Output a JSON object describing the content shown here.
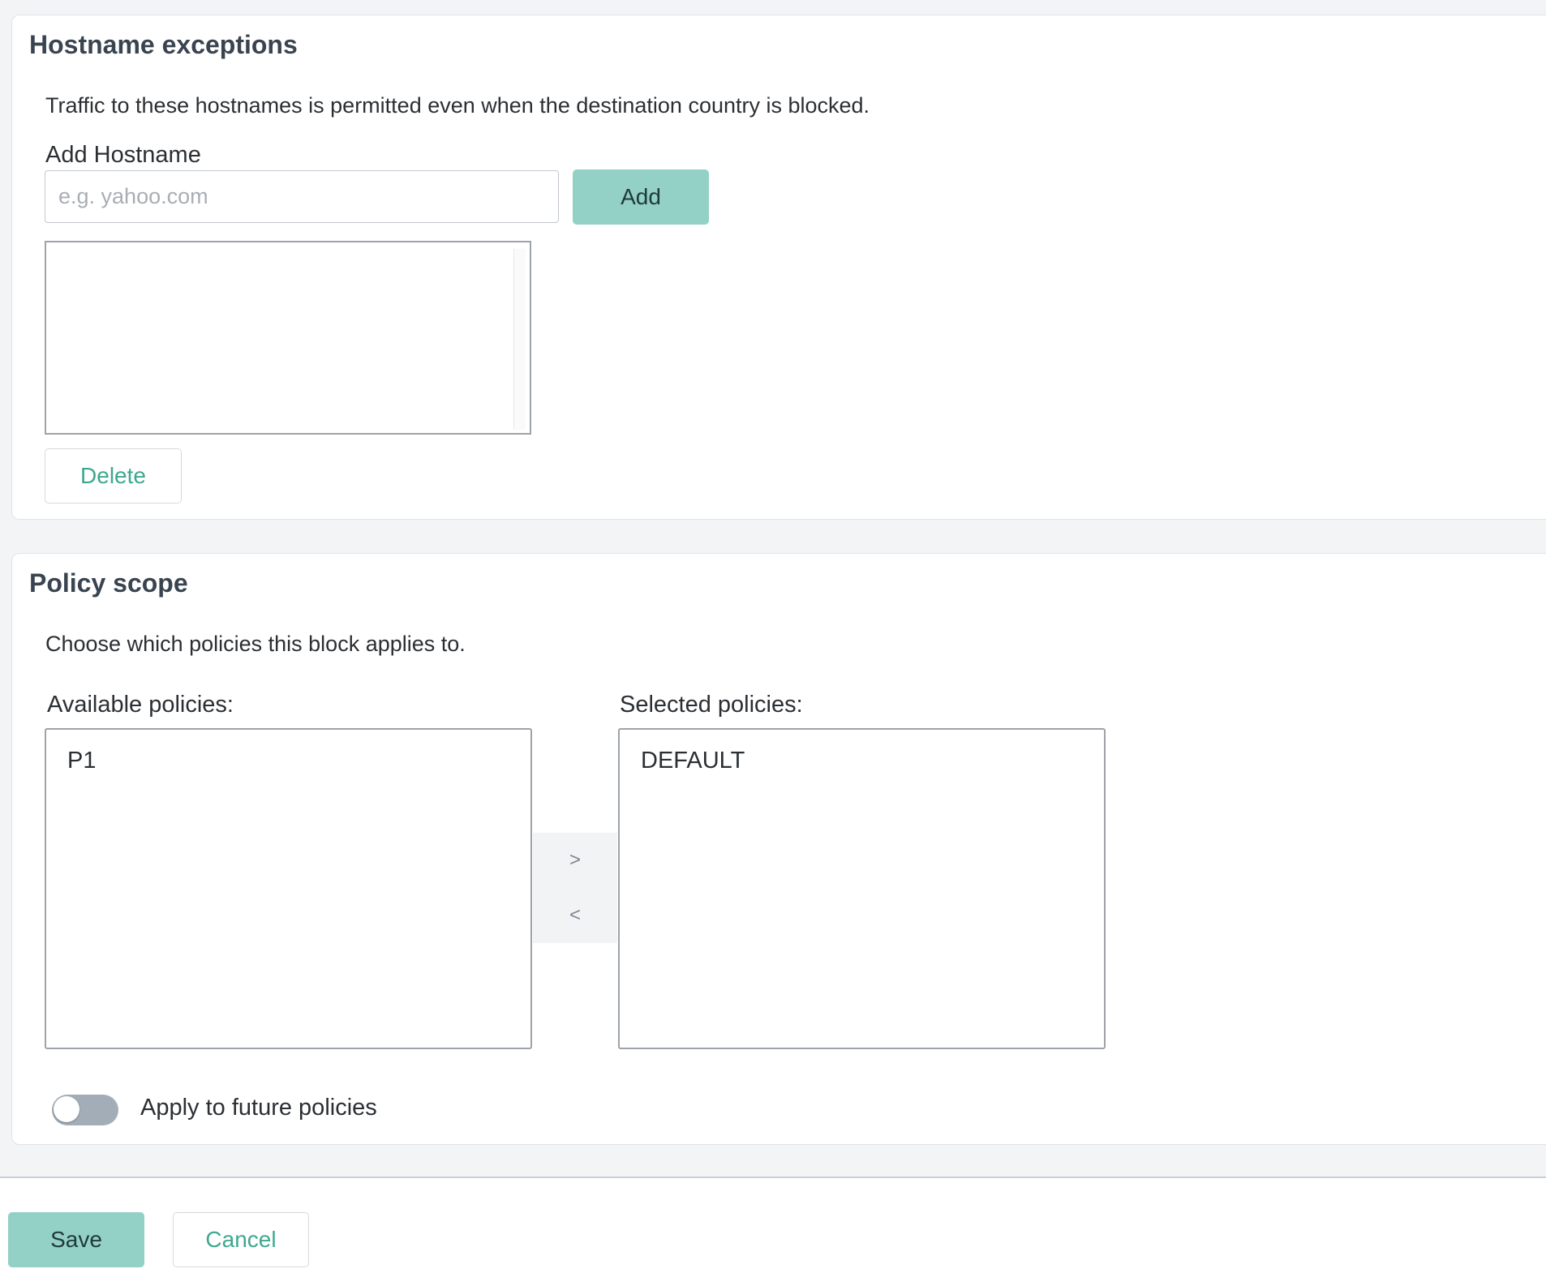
{
  "hostname_section": {
    "title": "Hostname exceptions",
    "description": "Traffic to these hostnames is permitted even when the destination country is blocked.",
    "add_label": "Add Hostname",
    "input_placeholder": "e.g. yahoo.com",
    "input_value": "",
    "add_button": "Add",
    "hostnames": [],
    "delete_button": "Delete"
  },
  "policy_section": {
    "title": "Policy scope",
    "description": "Choose which policies this block applies to.",
    "available_label": "Available policies:",
    "available": [
      "P1"
    ],
    "selected_label": "Selected policies:",
    "selected": [
      "DEFAULT"
    ],
    "move_right": ">",
    "move_left": "<",
    "future_toggle_on": false,
    "future_label": "Apply to future policies"
  },
  "footer": {
    "save_button": "Save",
    "cancel_button": "Cancel"
  },
  "colors": {
    "accent": "#93d0c5",
    "link": "#3ea88f",
    "toggle_off": "#a3adb8"
  }
}
